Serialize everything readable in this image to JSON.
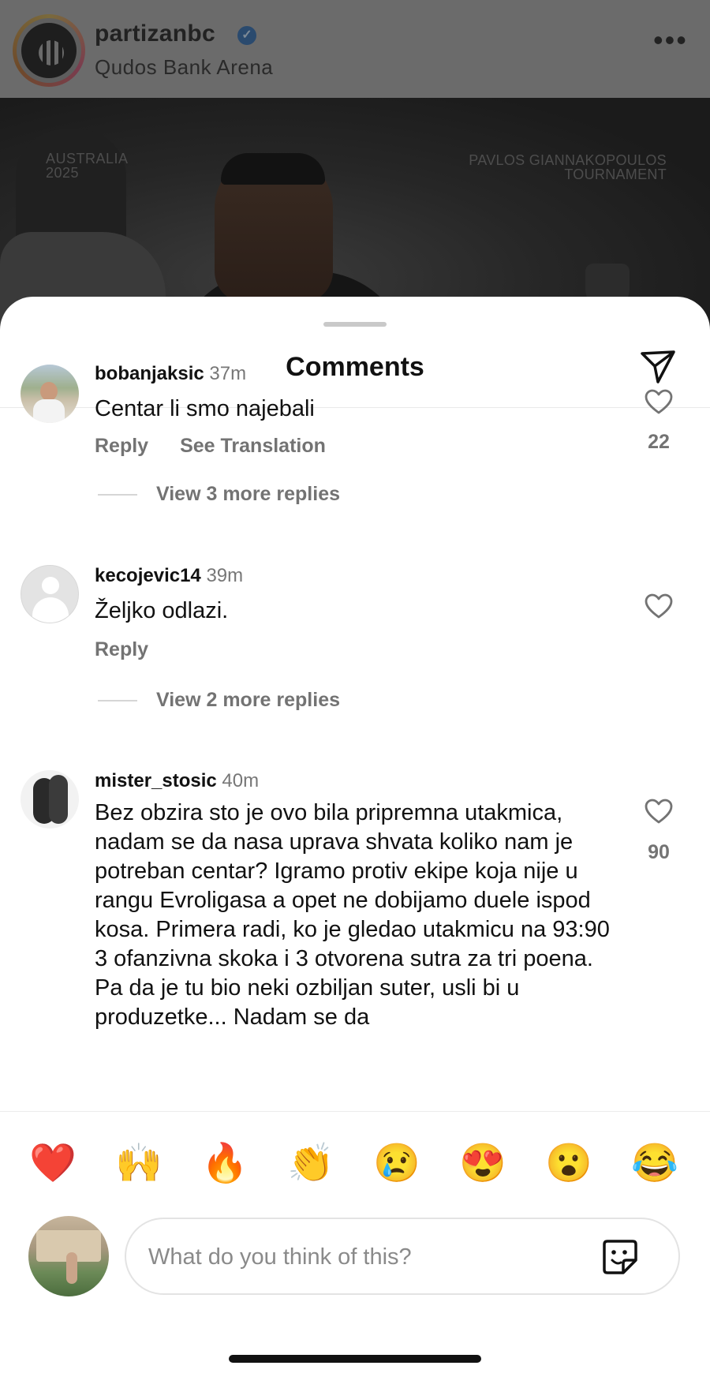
{
  "post": {
    "username": "partizanbc",
    "verified_mark": "✓",
    "location": "Qudos Bank Arena",
    "more_icon": "•••",
    "image_text_left": "AUSTRALIA\n2025",
    "image_text_right": "PAVLOS GIANNAKOPOULOS\nTOURNAMENT"
  },
  "sheet": {
    "title": "Comments"
  },
  "comments": [
    {
      "username": "bobanjaksic",
      "time": "37m",
      "text": "Centar li smo najebali",
      "actions": [
        "Reply",
        "See Translation"
      ],
      "likes": "22",
      "view_replies": "View 3 more replies"
    },
    {
      "username": "kecojevic14",
      "time": "39m",
      "text": "Željko odlazi.",
      "actions": [
        "Reply"
      ],
      "likes": "",
      "view_replies": "View 2 more replies"
    },
    {
      "username": "mister_stosic",
      "time": "40m",
      "text": "Bez obzira sto je ovo bila pripremna utakmica, nadam se da nasa uprava shvata koliko nam je potreban centar? Igramo protiv ekipe koja nije u rangu Evroligasa a opet ne dobijamo duele ispod kosa. Primera radi, ko je gledao utakmicu na 93:90 3 ofanzivna skoka i 3 otvorena sutra za tri poena. Pa da je tu bio neki ozbiljan suter, usli bi u produzetke... Nadam se da",
      "likes": "90"
    }
  ],
  "composer": {
    "emojis": [
      "❤️",
      "🙌",
      "🔥",
      "👏",
      "😢",
      "😍",
      "😮",
      "😂"
    ],
    "placeholder": "What do you think of this?"
  }
}
